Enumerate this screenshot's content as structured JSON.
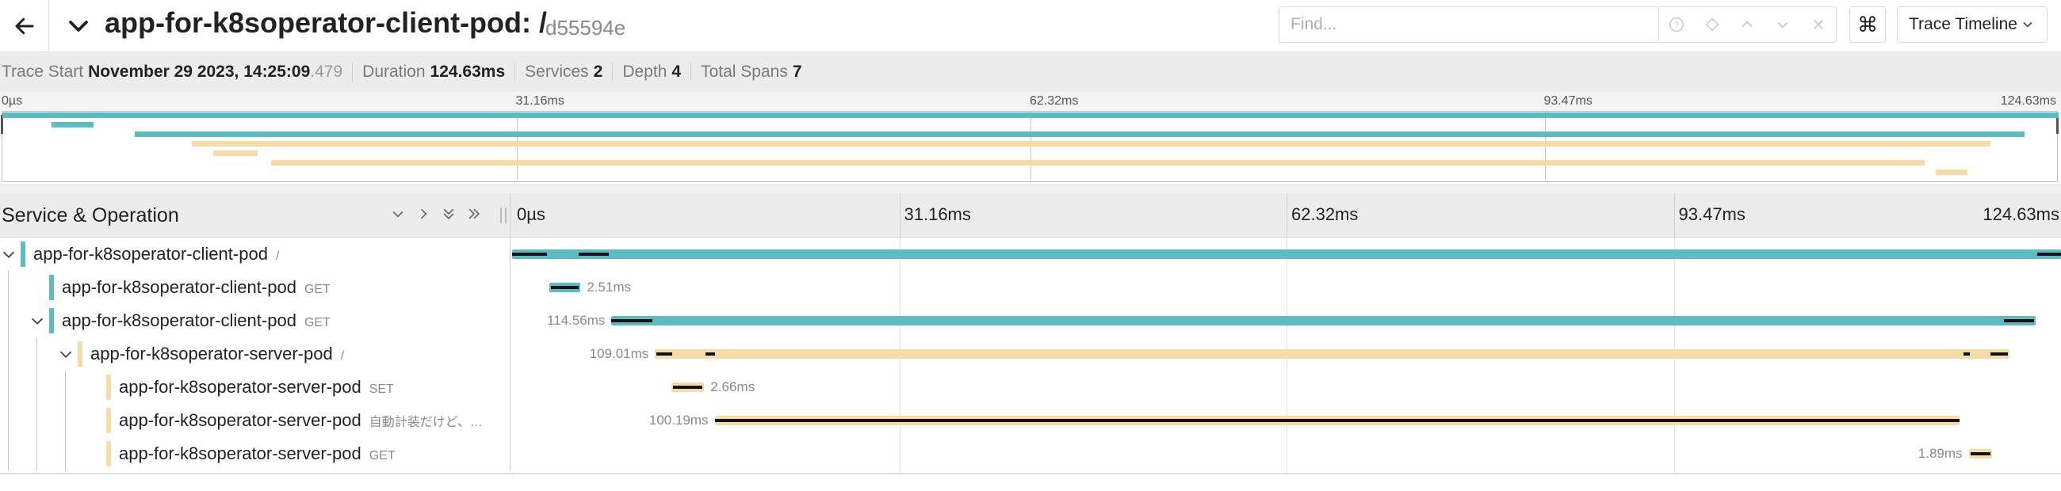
{
  "header": {
    "title": "app-for-k8soperator-client-pod: /",
    "trace_id": "d55594e",
    "find_placeholder": "Find...",
    "keyboard_shortcut_symbol": "⌘",
    "view_label": "Trace Timeline"
  },
  "summary": {
    "trace_start_label": "Trace Start",
    "trace_start_value": "November 29 2023, 14:25:09",
    "trace_start_ms": ".479",
    "duration_label": "Duration",
    "duration_value": "124.63ms",
    "services_label": "Services",
    "services_value": "2",
    "depth_label": "Depth",
    "depth_value": "4",
    "total_spans_label": "Total Spans",
    "total_spans_value": "7"
  },
  "minimap": {
    "ticks": [
      "0µs",
      "31.16ms",
      "62.32ms",
      "93.47ms",
      "124.63ms"
    ]
  },
  "timeline": {
    "column_label": "Service & Operation",
    "ticks": [
      "0µs",
      "31.16ms",
      "62.32ms",
      "93.47ms",
      "124.63ms"
    ]
  },
  "colors": {
    "client": "#5bbcc4",
    "server": "#f5dca8"
  },
  "spans": [
    {
      "service": "app-for-k8soperator-client-pod",
      "operation": "/",
      "depth": 0,
      "has_children": true,
      "expanded": true,
      "color": "client",
      "start_ms": 0,
      "duration_ms": 124.63,
      "duration_label": ""
    },
    {
      "service": "app-for-k8soperator-client-pod",
      "operation": "GET",
      "depth": 1,
      "has_children": false,
      "expanded": false,
      "color": "client",
      "start_ms": 3.0,
      "duration_ms": 2.51,
      "duration_label": "2.51ms"
    },
    {
      "service": "app-for-k8soperator-client-pod",
      "operation": "GET",
      "depth": 1,
      "has_children": true,
      "expanded": true,
      "color": "client",
      "start_ms": 8.0,
      "duration_ms": 114.56,
      "duration_label": "114.56ms"
    },
    {
      "service": "app-for-k8soperator-server-pod",
      "operation": "/",
      "depth": 2,
      "has_children": true,
      "expanded": true,
      "color": "server",
      "start_ms": 11.5,
      "duration_ms": 109.01,
      "duration_label": "109.01ms"
    },
    {
      "service": "app-for-k8soperator-server-pod",
      "operation": "SET",
      "depth": 3,
      "has_children": false,
      "expanded": false,
      "color": "server",
      "start_ms": 12.8,
      "duration_ms": 2.66,
      "duration_label": "2.66ms"
    },
    {
      "service": "app-for-k8soperator-server-pod",
      "operation": "自動計装だけど、…",
      "depth": 3,
      "has_children": false,
      "expanded": false,
      "color": "server",
      "start_ms": 16.3,
      "duration_ms": 100.19,
      "duration_label": "100.19ms"
    },
    {
      "service": "app-for-k8soperator-server-pod",
      "operation": "GET",
      "depth": 3,
      "has_children": false,
      "expanded": false,
      "color": "server",
      "start_ms": 117.2,
      "duration_ms": 1.89,
      "duration_label": "1.89ms"
    }
  ]
}
